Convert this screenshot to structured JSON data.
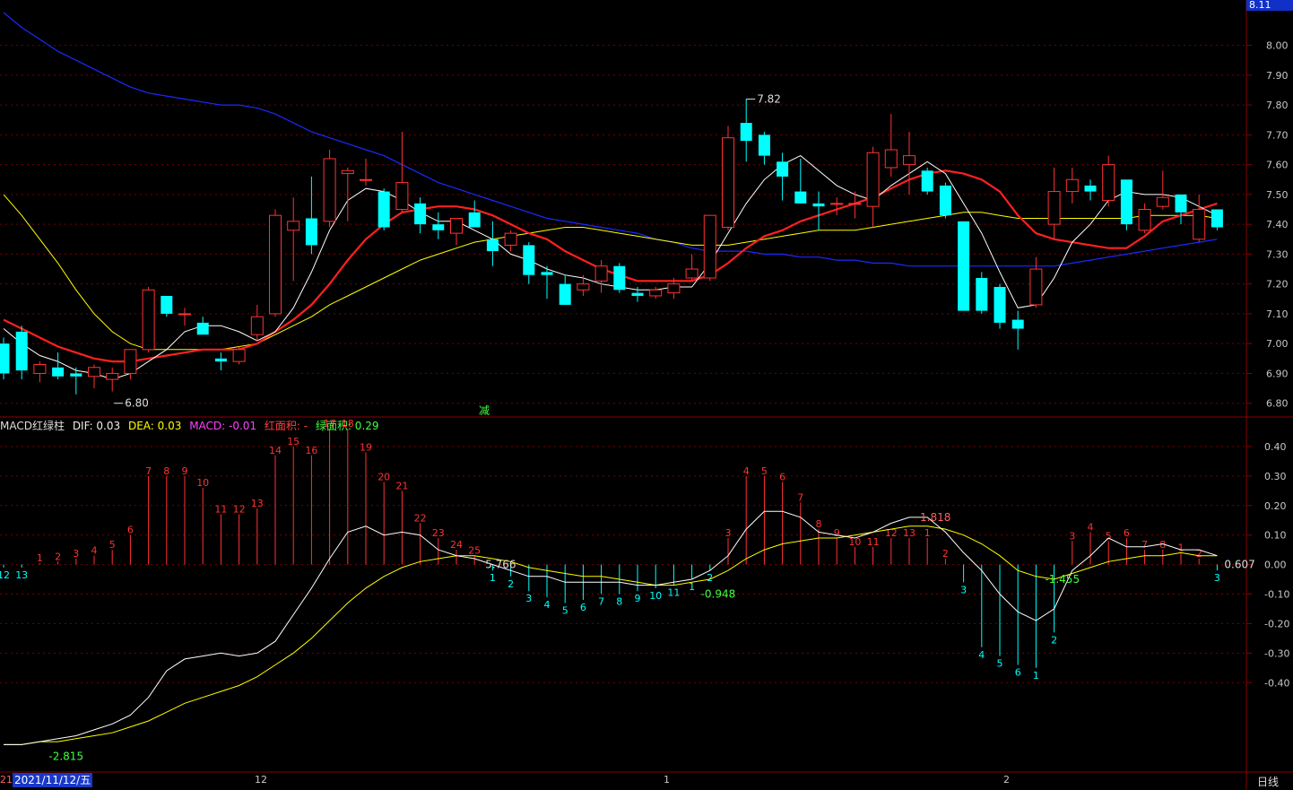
{
  "colors": {
    "up": "#ff3232",
    "down": "#00ffff",
    "ma_short": "#ffffff",
    "ma_mid": "#ff2020",
    "ma_long": "#ffff00",
    "ma_longest": "#1a2aff",
    "dif": "#ffffff",
    "dea": "#ffff00",
    "grid": "#7a0000",
    "frame": "#8a0000"
  },
  "header": {
    "price_box": "8.11"
  },
  "footer": {
    "date_box": "2021/11/12/五",
    "period": "日线",
    "left_tick": "21",
    "ticks": [
      "12",
      "1",
      "2"
    ]
  },
  "macd_title": {
    "name": "MACD红绿柱",
    "dif": "DIF: 0.03",
    "dea": "DEA: 0.03",
    "macd": "MACD: -0.01",
    "red_area": "红面积: -",
    "green_area": "绿面积: 0.29"
  },
  "chart_data": [
    {
      "type": "candlestick",
      "y_ticks": [
        "8.00",
        "7.90",
        "7.80",
        "7.70",
        "7.60",
        "7.50",
        "7.40",
        "7.30",
        "7.20",
        "7.10",
        "7.00",
        "6.90",
        "6.80"
      ],
      "ylim": [
        6.76,
        8.11
      ],
      "annotations": [
        {
          "text": "7.82"
        },
        {
          "text": "6.80"
        },
        {
          "text": "减"
        }
      ],
      "candles": [
        {
          "o": 7.0,
          "h": 7.02,
          "l": 6.88,
          "c": 6.9
        },
        {
          "o": 7.04,
          "h": 7.06,
          "l": 6.88,
          "c": 6.91
        },
        {
          "o": 6.9,
          "h": 6.94,
          "l": 6.87,
          "c": 6.93
        },
        {
          "o": 6.92,
          "h": 6.97,
          "l": 6.88,
          "c": 6.89
        },
        {
          "o": 6.9,
          "h": 6.92,
          "l": 6.83,
          "c": 6.89
        },
        {
          "o": 6.89,
          "h": 6.93,
          "l": 6.85,
          "c": 6.92
        },
        {
          "o": 6.88,
          "h": 6.92,
          "l": 6.84,
          "c": 6.9
        },
        {
          "o": 6.9,
          "h": 6.97,
          "l": 6.88,
          "c": 6.98
        },
        {
          "o": 6.98,
          "h": 7.19,
          "l": 6.97,
          "c": 7.18
        },
        {
          "o": 7.16,
          "h": 7.16,
          "l": 7.09,
          "c": 7.1
        },
        {
          "o": 7.1,
          "h": 7.12,
          "l": 7.06,
          "c": 7.1
        },
        {
          "o": 7.07,
          "h": 7.09,
          "l": 7.03,
          "c": 7.03
        },
        {
          "o": 6.95,
          "h": 6.97,
          "l": 6.91,
          "c": 6.94
        },
        {
          "o": 6.94,
          "h": 6.99,
          "l": 6.93,
          "c": 6.98
        },
        {
          "o": 7.03,
          "h": 7.13,
          "l": 7.01,
          "c": 7.09
        },
        {
          "o": 7.1,
          "h": 7.45,
          "l": 7.09,
          "c": 7.43
        },
        {
          "o": 7.38,
          "h": 7.49,
          "l": 7.21,
          "c": 7.41
        },
        {
          "o": 7.42,
          "h": 7.56,
          "l": 7.3,
          "c": 7.33
        },
        {
          "o": 7.41,
          "h": 7.65,
          "l": 7.39,
          "c": 7.62
        },
        {
          "o": 7.57,
          "h": 7.59,
          "l": 7.41,
          "c": 7.58
        },
        {
          "o": 7.55,
          "h": 7.62,
          "l": 7.53,
          "c": 7.55
        },
        {
          "o": 7.51,
          "h": 7.52,
          "l": 7.38,
          "c": 7.39
        },
        {
          "o": 7.45,
          "h": 7.71,
          "l": 7.44,
          "c": 7.54
        },
        {
          "o": 7.47,
          "h": 7.49,
          "l": 7.37,
          "c": 7.4
        },
        {
          "o": 7.4,
          "h": 7.44,
          "l": 7.35,
          "c": 7.38
        },
        {
          "o": 7.37,
          "h": 7.42,
          "l": 7.33,
          "c": 7.42
        },
        {
          "o": 7.44,
          "h": 7.48,
          "l": 7.39,
          "c": 7.39
        },
        {
          "o": 7.35,
          "h": 7.41,
          "l": 7.26,
          "c": 7.31
        },
        {
          "o": 7.33,
          "h": 7.38,
          "l": 7.31,
          "c": 7.37
        },
        {
          "o": 7.33,
          "h": 7.34,
          "l": 7.2,
          "c": 7.23
        },
        {
          "o": 7.24,
          "h": 7.26,
          "l": 7.15,
          "c": 7.23
        },
        {
          "o": 7.2,
          "h": 7.23,
          "l": 7.13,
          "c": 7.13
        },
        {
          "o": 7.18,
          "h": 7.23,
          "l": 7.16,
          "c": 7.2
        },
        {
          "o": 7.21,
          "h": 7.28,
          "l": 7.17,
          "c": 7.26
        },
        {
          "o": 7.26,
          "h": 7.27,
          "l": 7.17,
          "c": 7.18
        },
        {
          "o": 7.17,
          "h": 7.19,
          "l": 7.14,
          "c": 7.16
        },
        {
          "o": 7.16,
          "h": 7.19,
          "l": 7.15,
          "c": 7.18
        },
        {
          "o": 7.17,
          "h": 7.22,
          "l": 7.15,
          "c": 7.2
        },
        {
          "o": 7.22,
          "h": 7.3,
          "l": 7.21,
          "c": 7.25
        },
        {
          "o": 7.22,
          "h": 7.42,
          "l": 7.21,
          "c": 7.43
        },
        {
          "o": 7.39,
          "h": 7.73,
          "l": 7.38,
          "c": 7.69
        },
        {
          "o": 7.74,
          "h": 7.82,
          "l": 7.61,
          "c": 7.68
        },
        {
          "o": 7.7,
          "h": 7.71,
          "l": 7.6,
          "c": 7.63
        },
        {
          "o": 7.61,
          "h": 7.64,
          "l": 7.48,
          "c": 7.56
        },
        {
          "o": 7.51,
          "h": 7.62,
          "l": 7.48,
          "c": 7.47
        },
        {
          "o": 7.47,
          "h": 7.51,
          "l": 7.38,
          "c": 7.46
        },
        {
          "o": 7.47,
          "h": 7.49,
          "l": 7.43,
          "c": 7.47
        },
        {
          "o": 7.47,
          "h": 7.51,
          "l": 7.42,
          "c": 7.47
        },
        {
          "o": 7.46,
          "h": 7.66,
          "l": 7.39,
          "c": 7.64
        },
        {
          "o": 7.59,
          "h": 7.77,
          "l": 7.56,
          "c": 7.65
        },
        {
          "o": 7.6,
          "h": 7.71,
          "l": 7.5,
          "c": 7.63
        },
        {
          "o": 7.58,
          "h": 7.59,
          "l": 7.5,
          "c": 7.51
        },
        {
          "o": 7.53,
          "h": 7.54,
          "l": 7.42,
          "c": 7.43
        },
        {
          "o": 7.41,
          "h": 7.41,
          "l": 7.11,
          "c": 7.11
        },
        {
          "o": 7.22,
          "h": 7.24,
          "l": 7.1,
          "c": 7.11
        },
        {
          "o": 7.19,
          "h": 7.2,
          "l": 7.05,
          "c": 7.07
        },
        {
          "o": 7.08,
          "h": 7.11,
          "l": 6.98,
          "c": 7.05
        },
        {
          "o": 7.13,
          "h": 7.29,
          "l": 7.12,
          "c": 7.25
        },
        {
          "o": 7.4,
          "h": 7.59,
          "l": 7.35,
          "c": 7.51
        },
        {
          "o": 7.51,
          "h": 7.59,
          "l": 7.47,
          "c": 7.55
        },
        {
          "o": 7.53,
          "h": 7.55,
          "l": 7.48,
          "c": 7.51
        },
        {
          "o": 7.48,
          "h": 7.63,
          "l": 7.46,
          "c": 7.6
        },
        {
          "o": 7.55,
          "h": 7.55,
          "l": 7.38,
          "c": 7.4
        },
        {
          "o": 7.38,
          "h": 7.47,
          "l": 7.37,
          "c": 7.45
        },
        {
          "o": 7.46,
          "h": 7.58,
          "l": 7.45,
          "c": 7.49
        },
        {
          "o": 7.5,
          "h": 7.5,
          "l": 7.4,
          "c": 7.44
        },
        {
          "o": 7.35,
          "h": 7.5,
          "l": 7.34,
          "c": 7.45
        },
        {
          "o": 7.45,
          "h": 7.45,
          "l": 7.38,
          "c": 7.39
        }
      ],
      "ma5": [
        7.05,
        7.0,
        6.96,
        6.94,
        6.91,
        6.9,
        6.88,
        6.9,
        6.94,
        6.98,
        7.04,
        7.06,
        7.06,
        7.04,
        7.01,
        7.04,
        7.12,
        7.24,
        7.38,
        7.48,
        7.52,
        7.51,
        7.48,
        7.44,
        7.41,
        7.41,
        7.38,
        7.35,
        7.3,
        7.28,
        7.25,
        7.23,
        7.22,
        7.2,
        7.19,
        7.18,
        7.18,
        7.19,
        7.19,
        7.27,
        7.37,
        7.47,
        7.55,
        7.6,
        7.63,
        7.58,
        7.53,
        7.5,
        7.48,
        7.53,
        7.57,
        7.61,
        7.57,
        7.47,
        7.37,
        7.24,
        7.12,
        7.13,
        7.22,
        7.34,
        7.4,
        7.48,
        7.51,
        7.5,
        7.5,
        7.49,
        7.46,
        7.43
      ],
      "ma10": [
        7.08,
        7.05,
        7.02,
        6.99,
        6.97,
        6.95,
        6.94,
        6.94,
        6.95,
        6.96,
        6.97,
        6.98,
        6.98,
        6.98,
        7.0,
        7.04,
        7.08,
        7.13,
        7.2,
        7.28,
        7.35,
        7.4,
        7.44,
        7.45,
        7.46,
        7.46,
        7.45,
        7.43,
        7.4,
        7.37,
        7.35,
        7.31,
        7.28,
        7.25,
        7.23,
        7.21,
        7.21,
        7.21,
        7.21,
        7.23,
        7.27,
        7.32,
        7.36,
        7.38,
        7.41,
        7.43,
        7.45,
        7.47,
        7.49,
        7.52,
        7.55,
        7.57,
        7.58,
        7.57,
        7.55,
        7.51,
        7.43,
        7.37,
        7.35,
        7.34,
        7.33,
        7.32,
        7.32,
        7.36,
        7.41,
        7.43,
        7.45,
        7.47
      ],
      "ma30": [
        7.5,
        7.43,
        7.35,
        7.27,
        7.18,
        7.1,
        7.04,
        7.0,
        6.98,
        6.98,
        6.98,
        6.98,
        6.98,
        6.99,
        7.0,
        7.03,
        7.06,
        7.09,
        7.13,
        7.16,
        7.19,
        7.22,
        7.25,
        7.28,
        7.3,
        7.32,
        7.34,
        7.35,
        7.36,
        7.37,
        7.38,
        7.39,
        7.39,
        7.38,
        7.37,
        7.36,
        7.35,
        7.34,
        7.33,
        7.33,
        7.33,
        7.34,
        7.35,
        7.36,
        7.37,
        7.38,
        7.38,
        7.38,
        7.39,
        7.4,
        7.41,
        7.42,
        7.43,
        7.44,
        7.44,
        7.43,
        7.42,
        7.42,
        7.42,
        7.42,
        7.42,
        7.42,
        7.42,
        7.43,
        7.43,
        7.43,
        7.43,
        7.42
      ],
      "ma60": [
        8.11,
        8.06,
        8.02,
        7.98,
        7.95,
        7.92,
        7.89,
        7.86,
        7.84,
        7.83,
        7.82,
        7.81,
        7.8,
        7.8,
        7.79,
        7.77,
        7.74,
        7.71,
        7.69,
        7.67,
        7.65,
        7.63,
        7.6,
        7.57,
        7.54,
        7.52,
        7.5,
        7.48,
        7.46,
        7.44,
        7.42,
        7.41,
        7.4,
        7.39,
        7.38,
        7.37,
        7.35,
        7.34,
        7.32,
        7.31,
        7.31,
        7.31,
        7.3,
        7.3,
        7.29,
        7.29,
        7.28,
        7.28,
        7.27,
        7.27,
        7.26,
        7.26,
        7.26,
        7.26,
        7.26,
        7.26,
        7.26,
        7.26,
        7.26,
        7.27,
        7.28,
        7.29,
        7.3,
        7.31,
        7.32,
        7.33,
        7.34,
        7.35
      ]
    },
    {
      "type": "macd",
      "y_ticks": [
        "0.40",
        "0.30",
        "0.20",
        "0.10",
        "0.00",
        "-0.10",
        "-0.20",
        "-0.30",
        "-0.40"
      ],
      "ylim": [
        -0.7,
        0.5
      ],
      "annotations": [
        {
          "text": "-2.815"
        },
        {
          "text": "5.766"
        },
        {
          "text": "-0.948"
        },
        {
          "text": "1.818"
        },
        {
          "text": "-1.455"
        },
        {
          "text": "0.607"
        }
      ],
      "bars": [
        -0.01,
        -0.01,
        0.005,
        0.01,
        0.02,
        0.03,
        0.05,
        0.1,
        0.3,
        0.3,
        0.3,
        0.26,
        0.17,
        0.17,
        0.19,
        0.37,
        0.4,
        0.37,
        0.46,
        0.46,
        0.38,
        0.28,
        0.25,
        0.14,
        0.09,
        0.05,
        0.03,
        -0.02,
        -0.04,
        -0.09,
        -0.11,
        -0.13,
        -0.12,
        -0.1,
        -0.1,
        -0.09,
        -0.08,
        -0.07,
        -0.05,
        -0.02,
        0.09,
        0.3,
        0.3,
        0.28,
        0.21,
        0.12,
        0.09,
        0.06,
        0.06,
        0.09,
        0.09,
        0.09,
        0.02,
        -0.06,
        -0.28,
        -0.31,
        -0.34,
        -0.35,
        -0.23,
        0.08,
        0.11,
        0.08,
        0.09,
        0.05,
        0.05,
        0.04,
        0.02,
        -0.02
      ],
      "bar_counts": [
        "12",
        "13",
        "1",
        "2",
        "3",
        "4",
        "5",
        "6",
        "7",
        "8",
        "9",
        "10",
        "11",
        "12",
        "13",
        "14",
        "15",
        "16",
        "17",
        "18",
        "19",
        "20",
        "21",
        "22",
        "23",
        "24",
        "25",
        "1",
        "2",
        "3",
        "4",
        "5",
        "6",
        "7",
        "8",
        "9",
        "10",
        "11",
        "1",
        "2",
        "3",
        "4",
        "5",
        "6",
        "7",
        "8",
        "9",
        "10",
        "11",
        "12",
        "13",
        "1",
        "2",
        "3",
        "4",
        "5",
        "6",
        "1",
        "2",
        "3",
        "4",
        "5",
        "6",
        "7",
        "8",
        "1",
        "2",
        "3"
      ],
      "dif": [
        -0.61,
        -0.61,
        -0.6,
        -0.59,
        -0.58,
        -0.56,
        -0.54,
        -0.51,
        -0.45,
        -0.36,
        -0.32,
        -0.31,
        -0.3,
        -0.31,
        -0.3,
        -0.26,
        -0.17,
        -0.08,
        0.02,
        0.11,
        0.13,
        0.1,
        0.11,
        0.1,
        0.05,
        0.03,
        0.02,
        0.0,
        -0.02,
        -0.04,
        -0.04,
        -0.06,
        -0.06,
        -0.06,
        -0.06,
        -0.07,
        -0.07,
        -0.06,
        -0.05,
        -0.02,
        0.03,
        0.12,
        0.18,
        0.18,
        0.16,
        0.11,
        0.1,
        0.09,
        0.11,
        0.14,
        0.16,
        0.16,
        0.11,
        0.04,
        -0.02,
        -0.1,
        -0.16,
        -0.19,
        -0.15,
        -0.02,
        0.03,
        0.09,
        0.06,
        0.06,
        0.07,
        0.05,
        0.05,
        0.03
      ],
      "dea": [
        -0.61,
        -0.61,
        -0.6,
        -0.6,
        -0.59,
        -0.58,
        -0.57,
        -0.55,
        -0.53,
        -0.5,
        -0.47,
        -0.45,
        -0.43,
        -0.41,
        -0.38,
        -0.34,
        -0.3,
        -0.25,
        -0.19,
        -0.13,
        -0.08,
        -0.04,
        -0.01,
        0.01,
        0.02,
        0.03,
        0.03,
        0.02,
        0.01,
        -0.01,
        -0.02,
        -0.03,
        -0.04,
        -0.04,
        -0.05,
        -0.06,
        -0.07,
        -0.07,
        -0.06,
        -0.05,
        -0.02,
        0.02,
        0.05,
        0.07,
        0.08,
        0.09,
        0.09,
        0.1,
        0.11,
        0.12,
        0.13,
        0.13,
        0.12,
        0.1,
        0.07,
        0.03,
        -0.02,
        -0.04,
        -0.05,
        -0.03,
        -0.01,
        0.01,
        0.02,
        0.03,
        0.03,
        0.04,
        0.03,
        0.03
      ]
    }
  ]
}
